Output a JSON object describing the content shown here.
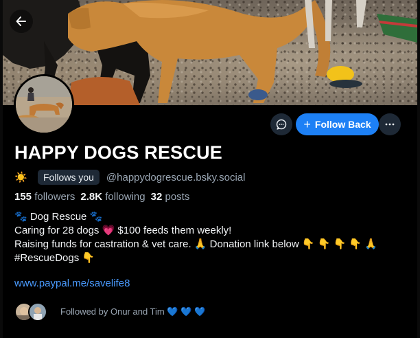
{
  "profile": {
    "display_name": "HAPPY DOGS RESCUE",
    "status_emoji": "☀️",
    "follows_you": "Follows you",
    "handle": "@happydogrescue.bsky.social",
    "stats": {
      "followers_count": "155",
      "followers_label": "followers",
      "following_count": "2.8K",
      "following_label": "following",
      "posts_count": "32",
      "posts_label": "posts"
    },
    "bio": [
      "🐾  Dog Rescue  🐾",
      "Caring for 28 dogs 💗  $100 feeds them weekly!",
      "Raising funds for castration & vet care. 🙏  Donation link below 👇 👇 👇 👇 🙏",
      "#RescueDogs 👇"
    ],
    "link": "www.paypal.me/savelife8",
    "followed_by": "Followed by Onur and Tim 💙 💙 💙"
  },
  "actions": {
    "follow_back": "Follow Back",
    "follow_plus": "+"
  },
  "icons": {
    "back": "back-arrow-icon",
    "message": "chat-bubble-icon",
    "more": "ellipsis-icon"
  },
  "colors": {
    "accent": "#1d80f5",
    "link": "#4a9bff",
    "muted": "#9aa6b3",
    "background": "#000000",
    "button_dark": "#1e2936",
    "heart_blue": "#2f7cf6"
  }
}
